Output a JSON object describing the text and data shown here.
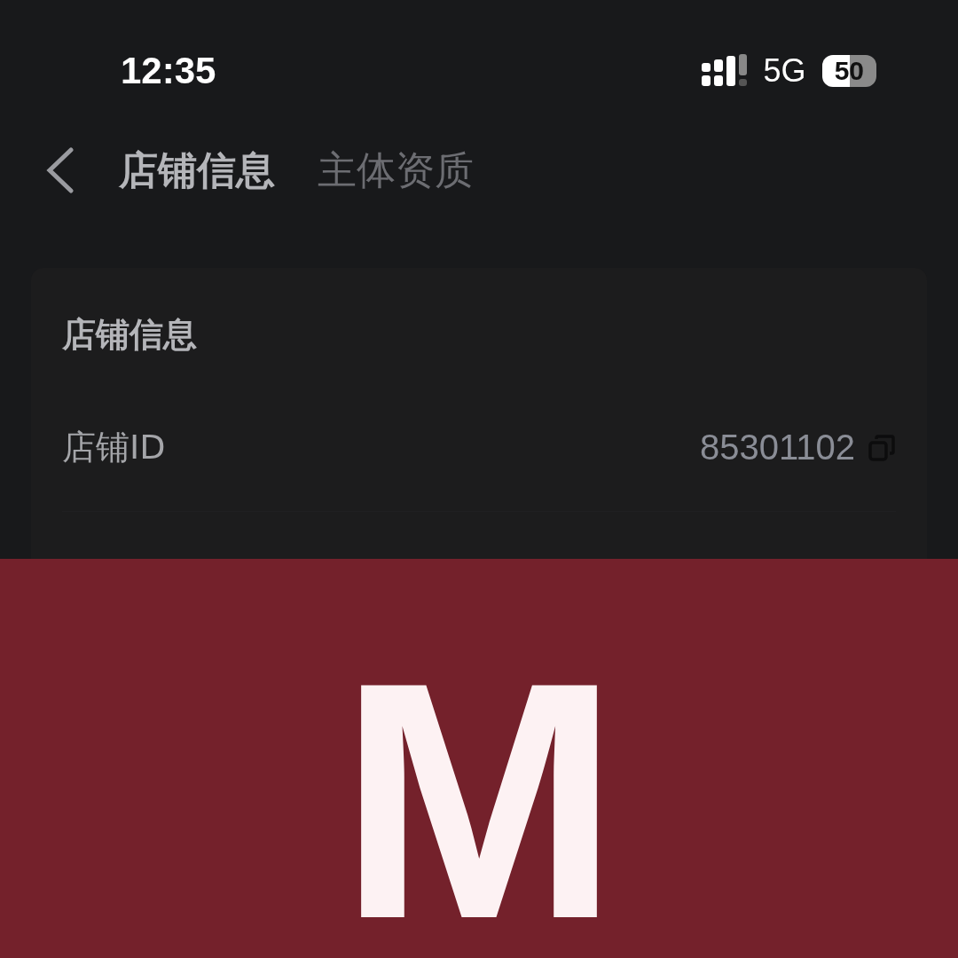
{
  "status_bar": {
    "time": "12:35",
    "network": "5G",
    "battery": "50"
  },
  "tabs": [
    {
      "label": "店铺信息",
      "selected": true
    },
    {
      "label": "主体资质",
      "selected": false
    }
  ],
  "card": {
    "title": "店铺信息",
    "rows": [
      {
        "label": "店铺ID",
        "value": "85301102"
      }
    ]
  },
  "banner": {
    "logo": "M"
  }
}
